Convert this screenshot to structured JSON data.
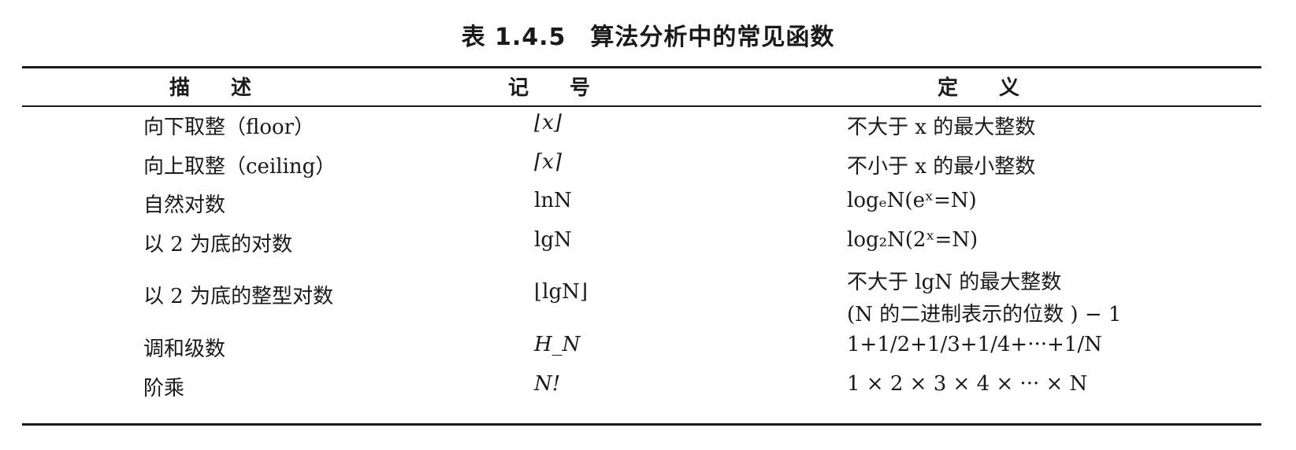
{
  "table": {
    "caption": "表 1.4.5　算法分析中的常见函数",
    "headers": {
      "description": "描　　述",
      "notation": "记　　号",
      "definition": "定　　义"
    },
    "rows": [
      {
        "description": "向下取整（floor）",
        "notation": "⌊x⌋",
        "definition": "不大于 x 的最大整数"
      },
      {
        "description": "向上取整（ceiling）",
        "notation": "⌈x⌉",
        "definition": "不小于 x 的最小整数"
      },
      {
        "description": "自然对数",
        "notation": "lnN",
        "definition": "logₑN(eˣ=N)"
      },
      {
        "description": "以 2 为底的对数",
        "notation": "lgN",
        "definition": "log₂N(2ˣ=N)"
      },
      {
        "description": "以 2 为底的整型对数",
        "notation": "⌊lgN⌋",
        "definition": "不大于 lgN 的最大整数",
        "definition_line2": "(N 的二进制表示的位数 ) − 1"
      },
      {
        "description": "调和级数",
        "notation": "H_N",
        "definition": "1+1/2+1/3+1/4+···+1/N"
      },
      {
        "description": "阶乘",
        "notation": "N!",
        "definition": "1 × 2 × 3 × 4 × ··· × N"
      }
    ]
  }
}
